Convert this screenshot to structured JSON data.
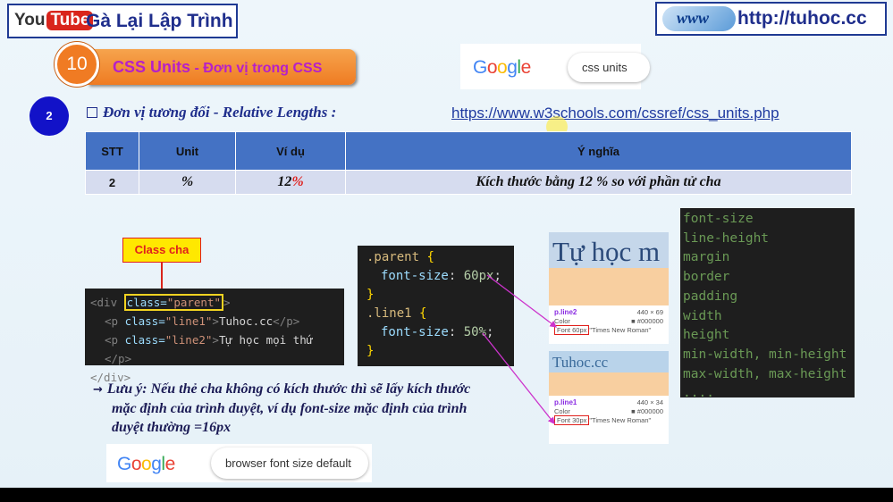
{
  "header": {
    "yt_logo_you": "You",
    "yt_logo_tube": "Tube",
    "channel_name": "Gà Lại Lập Trình",
    "www_logo": "www",
    "site_url": "http://tuhoc.cc"
  },
  "section": {
    "number": "10",
    "title": "CSS Units",
    "subtitle": " - Đơn vị trong CSS"
  },
  "google_top": {
    "logo": [
      "G",
      "o",
      "o",
      "g",
      "l",
      "e"
    ],
    "query": "css units"
  },
  "subsection": {
    "number": "2",
    "heading": "Đơn vị tương đối - Relative Lengths :",
    "link": "https://www.w3schools.com/cssref/css_units.php"
  },
  "table": {
    "headers": [
      "STT",
      "Unit",
      "Ví dụ",
      "Ý nghĩa"
    ],
    "row": {
      "stt": "2",
      "unit": "%",
      "example_num": "12",
      "example_unit": "%",
      "meaning": "Kích thước bằng 12 % so với phần tử cha"
    }
  },
  "class_cha_label": "Class cha",
  "html_code": {
    "line1_open": "<div ",
    "line1_attr": "class=",
    "line1_val": "\"parent\"",
    "line1_close": ">",
    "line2_open": "<p ",
    "line2_attr": "class=",
    "line2_val": "\"line1\"",
    "line2_text": "Tuhoc.cc",
    "line2_close": "</p>",
    "line3_open": "<p ",
    "line3_attr": "class=",
    "line3_val": "\"line2\"",
    "line3_text": "Tự học mọi thứ ",
    "line3_close": "</p>",
    "line4": "</div>"
  },
  "css_code": {
    "sel1": ".parent",
    "prop1": "font-size",
    "val1": "60px",
    "sel2": ".line1",
    "prop2": "font-size",
    "val2": "50%"
  },
  "props_list": [
    "font-size",
    "line-height",
    "margin",
    "border",
    "padding",
    "width",
    "height",
    "min-width, min-height",
    "max-width, max-height",
    "...."
  ],
  "preview1": {
    "heading": "Tự học m",
    "el": "p.line2",
    "size": "440 × 69",
    "color_label": "Color",
    "color_val": "#000000",
    "font_label": "Font",
    "font_size": "60px",
    "font_family": "\"Times New Roman\""
  },
  "preview2": {
    "heading": "Tuhoc.cc",
    "el": "p.line1",
    "size": "440 × 34",
    "color_label": "Color",
    "color_val": "#000000",
    "font_label": "Font",
    "font_size": "30px",
    "font_family": "\"Times New Roman\""
  },
  "note": {
    "arrow": "→",
    "line1": "Lưu ý: Nếu thẻ cha không có kích thước thì sẽ lấy kích thước",
    "line2": "mặc định của trình duyệt, ví dụ font-size mặc định của trình",
    "line3": "duyệt thường =16px"
  },
  "google_bottom": {
    "logo": [
      "G",
      "o",
      "o",
      "g",
      "l",
      "e"
    ],
    "query": "browser font size default"
  }
}
